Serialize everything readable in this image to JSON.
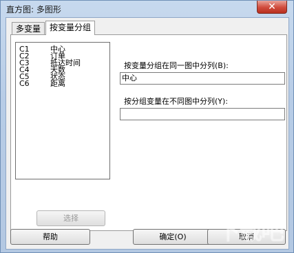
{
  "window": {
    "title": "直方图: 多图形",
    "close_glyph": "✕"
  },
  "tabs": [
    {
      "label": "多变量"
    },
    {
      "label": "按变量分组"
    }
  ],
  "variables": [
    {
      "col": "C1",
      "name": "中心"
    },
    {
      "col": "C2",
      "name": "订单"
    },
    {
      "col": "C3",
      "name": "抵达时间"
    },
    {
      "col": "C4",
      "name": "天数"
    },
    {
      "col": "C5",
      "name": "状态"
    },
    {
      "col": "C6",
      "name": "距离"
    }
  ],
  "same_graph": {
    "label": "按变量分组在同一图中分列(B):",
    "value": "中心"
  },
  "separate_graphs": {
    "label": "按分组变量在不同图中分列(Y):",
    "value": ""
  },
  "buttons": {
    "select": "选择",
    "help": "帮助",
    "ok": "确定(O)",
    "cancel": "取消"
  },
  "watermark": "下载吧"
}
